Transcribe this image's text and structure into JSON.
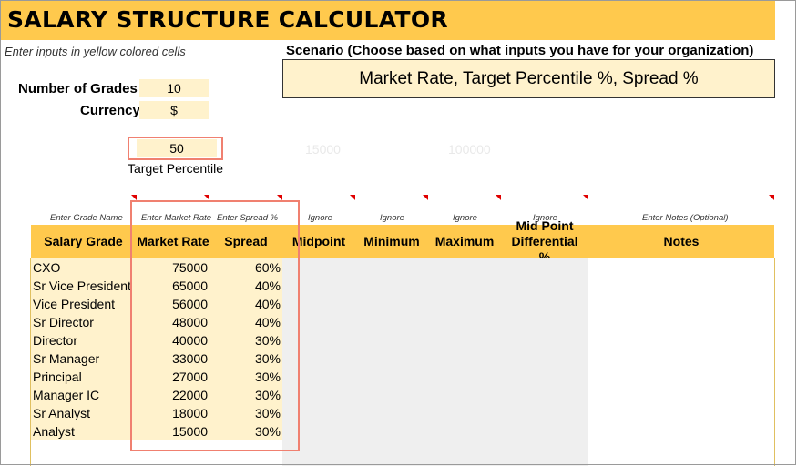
{
  "title": "SALARY STRUCTURE CALCULATOR",
  "input_hint": "Enter inputs in yellow colored cells",
  "scenario": {
    "label": "Scenario (Choose based on what inputs you have for your organization)",
    "value": "Market Rate, Target Percentile %, Spread %"
  },
  "grades": {
    "label": "Number of Grades",
    "value": "10"
  },
  "currency": {
    "label": "Currency",
    "value": "$"
  },
  "target_percentile": {
    "value": "50",
    "label": "Target Percentile"
  },
  "ghost_values": [
    "15000",
    "100000"
  ],
  "column_hints": [
    "Enter Grade Name",
    "Enter Market Rate",
    "Enter Spread %",
    "Ignore",
    "Ignore",
    "Ignore",
    "Ignore",
    "Enter Notes (Optional)"
  ],
  "columns": [
    "Salary Grade",
    "Market Rate",
    "Spread",
    "Midpoint",
    "Minimum",
    "Maximum",
    "Mid Point Differential %",
    "Notes"
  ],
  "rows": [
    {
      "grade": "CXO",
      "rate": "75000",
      "spread": "60%"
    },
    {
      "grade": "Sr Vice President",
      "rate": "65000",
      "spread": "40%"
    },
    {
      "grade": "Vice President",
      "rate": "56000",
      "spread": "40%"
    },
    {
      "grade": "Sr Director",
      "rate": "48000",
      "spread": "40%"
    },
    {
      "grade": "Director",
      "rate": "40000",
      "spread": "30%"
    },
    {
      "grade": "Sr Manager",
      "rate": "33000",
      "spread": "30%"
    },
    {
      "grade": "Principal",
      "rate": "27000",
      "spread": "30%"
    },
    {
      "grade": "Manager IC",
      "rate": "22000",
      "spread": "30%"
    },
    {
      "grade": "Sr Analyst",
      "rate": "18000",
      "spread": "30%"
    },
    {
      "grade": "Analyst",
      "rate": "15000",
      "spread": "30%"
    }
  ],
  "colors": {
    "accent": "#ffc94d",
    "input_fill": "#fff2cc",
    "highlight": "#f08070",
    "comment_marker": "#e00000"
  }
}
